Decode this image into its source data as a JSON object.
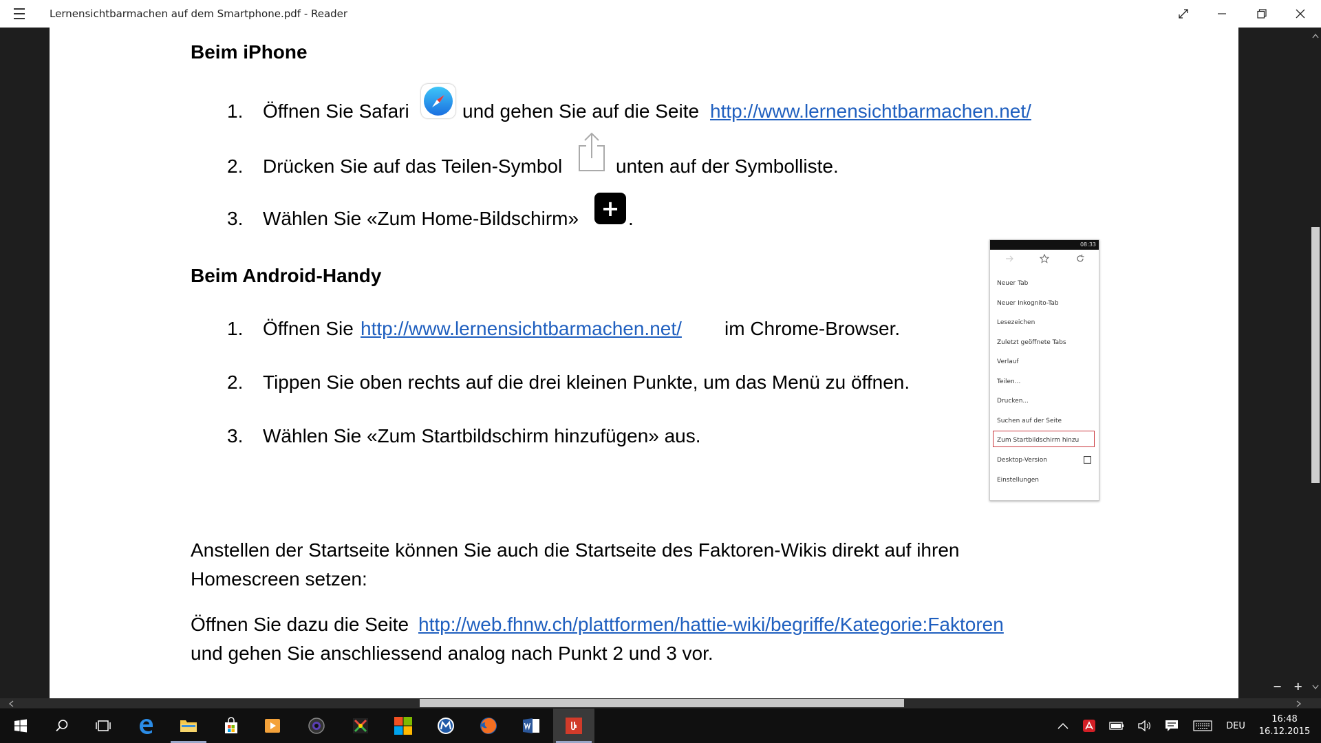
{
  "window": {
    "title": "Lernensichtbarmachen auf dem Smartphone.pdf - Reader"
  },
  "document": {
    "iphone_heading": "Beim iPhone",
    "iphone_steps": [
      {
        "num": "1.",
        "pre": "Öffnen Sie Safari",
        "mid": "und gehen Sie auf die Seite",
        "link": "http://www.lernensichtbarmachen.net/"
      },
      {
        "num": "2.",
        "pre": "Drücken Sie auf das Teilen-Symbol",
        "post": "unten auf der Symbolliste."
      },
      {
        "num": "3.",
        "pre": "Wählen Sie «Zum Home-Bildschirm»",
        "post": "."
      }
    ],
    "plus_glyph": "+",
    "android_heading": "Beim Android-Handy",
    "android_steps": [
      {
        "num": "1.",
        "pre": "Öffnen Sie",
        "link": "http://www.lernensichtbarmachen.net/",
        "post": "im Chrome-Browser."
      },
      {
        "num": "2.",
        "text": "Tippen Sie oben rechts auf die drei kleinen Punkte, um das Menü zu öffnen."
      },
      {
        "num": "3.",
        "text": "Wählen Sie «Zum Startbildschirm hinzufügen» aus."
      }
    ],
    "para1_line1": "Anstellen der Startseite können Sie auch die Startseite des Faktoren-Wikis direkt auf ihren",
    "para1_line2": "Homescreen setzen:",
    "para2_pre": "Öffnen Sie dazu die Seite",
    "para2_link": "http://web.fhnw.ch/plattformen/hattie-wiki/begriffe/Kategorie:Faktoren",
    "para2_line2": "und gehen Sie anschliessend analog nach Punkt 2 und 3 vor."
  },
  "phone_menu": {
    "status": "08:33",
    "items": [
      "Neuer Tab",
      "Neuer Inkognito-Tab",
      "Lesezeichen",
      "Zuletzt geöffnete Tabs",
      "Verlauf",
      "Teilen...",
      "Drucken...",
      "Suchen auf der Seite",
      "Zum Startbildschirm hinzu",
      "Desktop-Version",
      "Einstellungen"
    ],
    "highlight_color": "#c9343a"
  },
  "zoom": {
    "minus": "−",
    "plus": "+"
  },
  "taskbar": {
    "language": "DEU",
    "time": "16:48",
    "date": "16.12.2015"
  },
  "colors": {
    "link": "#1f5fbf",
    "taskbar": "#101010"
  }
}
